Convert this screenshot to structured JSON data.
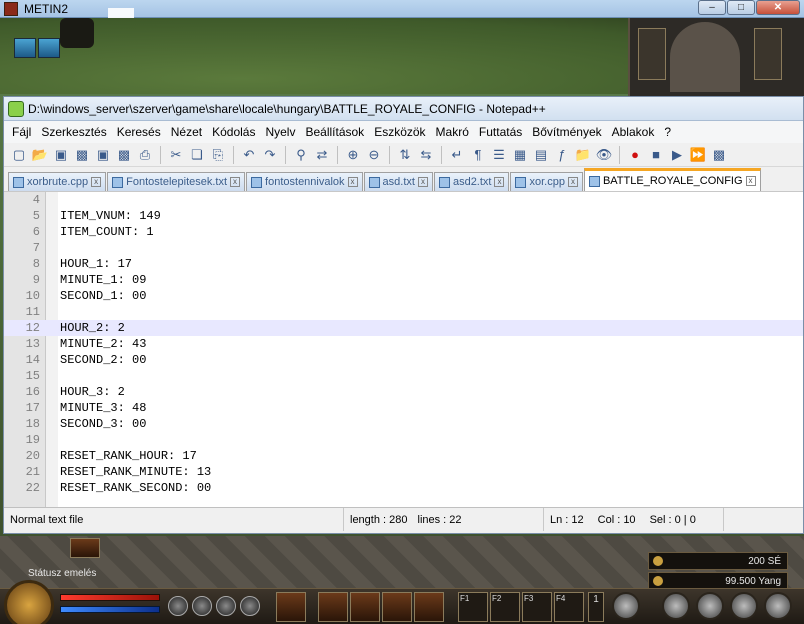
{
  "game": {
    "title": "METIN2",
    "status_label": "Státusz emelés",
    "money": [
      {
        "label": "200 SÉ"
      },
      {
        "label": "99.500 Yang"
      }
    ],
    "quickbar_keys": [
      "F1",
      "F2",
      "F3",
      "F4"
    ],
    "page_number": "1"
  },
  "window_controls": {
    "minimize": "–",
    "maximize": "□",
    "close": "✕"
  },
  "notepad": {
    "title": "D:\\windows_server\\szerver\\game\\share\\locale\\hungary\\BATTLE_ROYALE_CONFIG - Notepad++",
    "menu": [
      "Fájl",
      "Szerkesztés",
      "Keresés",
      "Nézet",
      "Kódolás",
      "Nyelv",
      "Beállítások",
      "Eszközök",
      "Makró",
      "Futtatás",
      "Bővítmények",
      "Ablakok",
      "?"
    ],
    "tabs": [
      {
        "label": "xorbrute.cpp",
        "active": false
      },
      {
        "label": "Fontostelepitesek.txt",
        "active": false
      },
      {
        "label": "fontostennivalok",
        "active": false
      },
      {
        "label": "asd.txt",
        "active": false
      },
      {
        "label": "asd2.txt",
        "active": false
      },
      {
        "label": "xor.cpp",
        "active": false
      },
      {
        "label": "BATTLE_ROYALE_CONFIG",
        "active": true
      }
    ],
    "lines": [
      {
        "n": "4",
        "text": ""
      },
      {
        "n": "5",
        "text": "ITEM_VNUM: 149"
      },
      {
        "n": "6",
        "text": "ITEM_COUNT: 1"
      },
      {
        "n": "7",
        "text": ""
      },
      {
        "n": "8",
        "text": "HOUR_1: 17"
      },
      {
        "n": "9",
        "text": "MINUTE_1: 09"
      },
      {
        "n": "10",
        "text": "SECOND_1: 00"
      },
      {
        "n": "11",
        "text": ""
      },
      {
        "n": "12",
        "text": "HOUR_2: 2"
      },
      {
        "n": "13",
        "text": "MINUTE_2: 43"
      },
      {
        "n": "14",
        "text": "SECOND_2: 00"
      },
      {
        "n": "15",
        "text": ""
      },
      {
        "n": "16",
        "text": "HOUR_3: 2"
      },
      {
        "n": "17",
        "text": "MINUTE_3: 48"
      },
      {
        "n": "18",
        "text": "SECOND_3: 00"
      },
      {
        "n": "19",
        "text": ""
      },
      {
        "n": "20",
        "text": "RESET_RANK_HOUR: 17"
      },
      {
        "n": "21",
        "text": "RESET_RANK_MINUTE: 13"
      },
      {
        "n": "22",
        "text": "RESET_RANK_SECOND: 00"
      }
    ],
    "current_line": "12",
    "status": {
      "file_type": "Normal text file",
      "length": "length : 280",
      "lines": "lines : 22",
      "ln": "Ln : 12",
      "col": "Col : 10",
      "sel": "Sel : 0 | 0"
    },
    "toolbar_icons": [
      "new-file-icon",
      "open-file-icon",
      "save-icon",
      "save-all-icon",
      "close-icon",
      "close-all-icon",
      "print-icon",
      "cut-icon",
      "copy-icon",
      "paste-icon",
      "undo-icon",
      "redo-icon",
      "find-icon",
      "replace-icon",
      "zoom-in-icon",
      "zoom-out-icon",
      "sync-v-icon",
      "sync-h-icon",
      "word-wrap-icon",
      "all-chars-icon",
      "indent-guide-icon",
      "udl-icon",
      "doc-map-icon",
      "function-list-icon",
      "folder-workspace-icon",
      "monitoring-icon",
      "record-macro-icon",
      "stop-macro-icon",
      "play-macro-icon",
      "run-macro-multiple-icon",
      "save-macro-icon"
    ]
  }
}
